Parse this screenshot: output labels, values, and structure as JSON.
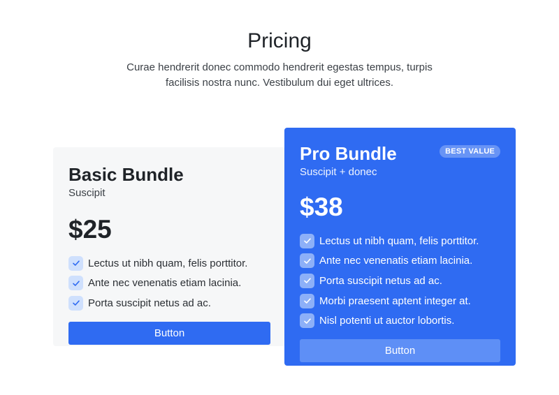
{
  "header": {
    "title": "Pricing",
    "subtitle": "Curae hendrerit donec commodo hendrerit egestas tempus, turpis facilisis nostra nunc. Vestibulum dui eget ultrices."
  },
  "plans": [
    {
      "name": "Basic Bundle",
      "subtitle": "Suscipit",
      "price": "$25",
      "features": [
        "Lectus ut nibh quam, felis porttitor.",
        "Ante nec venenatis etiam lacinia.",
        "Porta suscipit netus ad ac."
      ],
      "button_label": "Button"
    },
    {
      "name": "Pro Bundle",
      "badge": "BEST VALUE",
      "subtitle": "Suscipit + donec",
      "price": "$38",
      "features": [
        "Lectus ut nibh quam, felis porttitor.",
        "Ante nec venenatis etiam lacinia.",
        "Porta suscipit netus ad ac.",
        "Morbi praesent aptent integer at.",
        "Nisl potenti ut auctor lobortis."
      ],
      "button_label": "Button"
    }
  ],
  "colors": {
    "accent": "#2f6bf2",
    "basic_card_bg": "#f6f7f8",
    "check_bg_basic": "#cfe0fd",
    "check_bg_pro": "#8db0f8",
    "pro_button_bg": "#5e8ff6"
  },
  "icons": {
    "feature": "check-icon"
  }
}
